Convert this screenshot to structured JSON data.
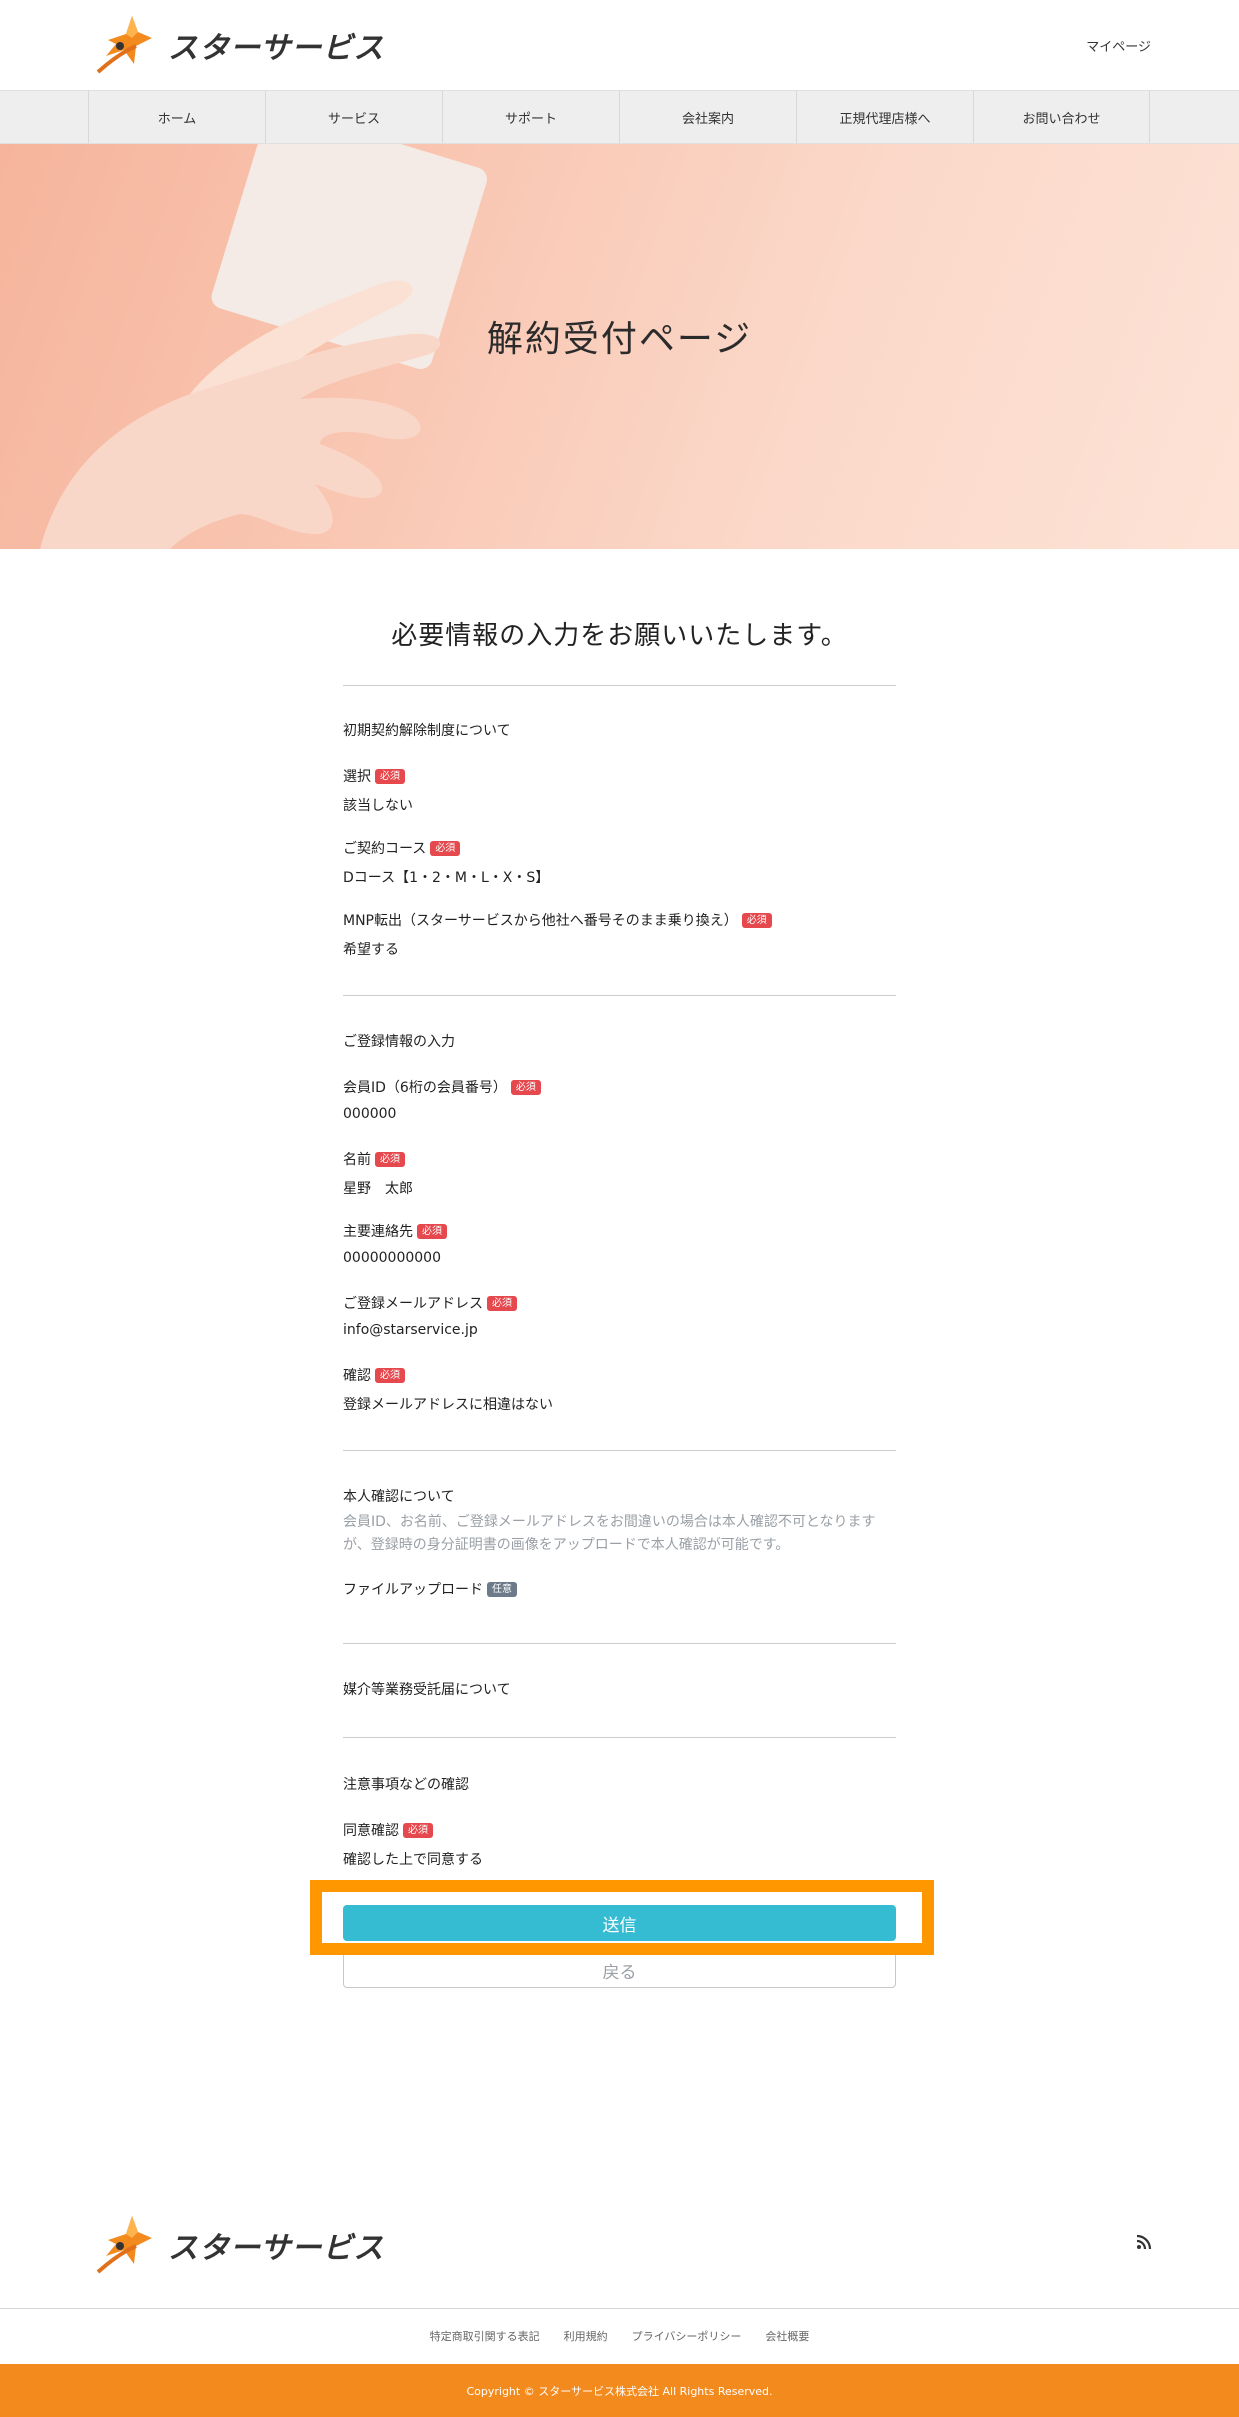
{
  "header": {
    "logo_text": "スターサービス",
    "mypage_label": "マイページ"
  },
  "nav": {
    "items": [
      "ホーム",
      "サービス",
      "サポート",
      "会社案内",
      "正規代理店様へ",
      "お問い合わせ"
    ]
  },
  "hero": {
    "title": "解約受付ページ"
  },
  "form": {
    "heading": "必要情報の入力をお願いいたします。",
    "section1": {
      "title": "初期契約解除制度について",
      "select_label": "選択",
      "select_value": "該当しない",
      "course_label": "ご契約コース",
      "course_value": "Dコース【1・2・M・L・X・S】",
      "mnp_label": "MNP転出（スターサービスから他社へ番号そのまま乗り換え）",
      "mnp_value": "希望する"
    },
    "section2": {
      "title": "ご登録情報の入力",
      "member_label": "会員ID（6桁の会員番号）",
      "member_value": "000000",
      "name_label": "名前",
      "name_value": "星野　太郎",
      "phone_label": "主要連絡先",
      "phone_value": "00000000000",
      "email_label": "ご登録メールアドレス",
      "email_value": "info@starservice.jp",
      "confirm_label": "確認",
      "confirm_value": "登録メールアドレスに相違はない"
    },
    "section3": {
      "title": "本人確認について",
      "note_line1": "会員ID、お名前、ご登録メールアドレスをお間違いの場合は本人確認不可となります",
      "note_line2": "が、登録時の身分証明書の画像をアップロードで本人確認が可能です。",
      "upload_label": "ファイルアップロード",
      "optional_badge": "任意"
    },
    "section4": {
      "title": "媒介等業務受託届について"
    },
    "section5": {
      "title": "注意事項などの確認",
      "agree_label": "同意確認",
      "agree_value": "確認した上で同意する"
    },
    "required_badge": "必須",
    "submit_label": "送信",
    "back_label": "戻る"
  },
  "footer": {
    "logo_text": "スターサービス",
    "links": [
      "特定商取引関する表記",
      "利用規約",
      "プライバシーポリシー",
      "会社概要"
    ],
    "copyright": "Copyright © スターサービス株式会社 All Rights Reserved."
  },
  "colors": {
    "accent": "#f28a1e",
    "submit": "#35bcd3",
    "required": "#e5484d",
    "highlight": "#ff9800"
  }
}
